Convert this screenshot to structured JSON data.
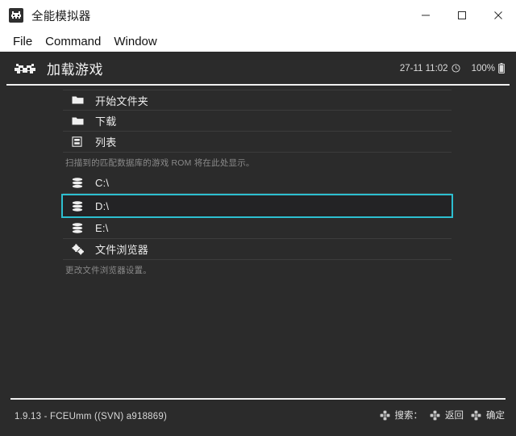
{
  "window": {
    "title": "全能模拟器",
    "app_icon": "arcade-invader-icon",
    "controls": {
      "minimize": "minimize-icon",
      "maximize": "maximize-icon",
      "close": "close-icon"
    }
  },
  "menubar": {
    "items": [
      {
        "label": "File"
      },
      {
        "label": "Command"
      },
      {
        "label": "Window"
      }
    ]
  },
  "header": {
    "icon": "space-invader-icon",
    "title": "加载游戏",
    "clock": {
      "text": "27-11 11:02",
      "icon": "clock-icon"
    },
    "battery": {
      "text": "100%",
      "icon": "battery-icon"
    }
  },
  "list": {
    "items": [
      {
        "icon": "folder-icon",
        "label": "开始文件夹",
        "selected": false
      },
      {
        "icon": "folder-icon",
        "label": "下载",
        "selected": false
      },
      {
        "icon": "list-icon",
        "label": "列表",
        "selected": false
      }
    ],
    "hint_scan": "扫描到的匹配数据库的游戏 ROM 将在此处显示。",
    "drives": [
      {
        "icon": "drive-icon",
        "label": "C:\\",
        "selected": false
      },
      {
        "icon": "drive-icon",
        "label": "D:\\",
        "selected": true
      },
      {
        "icon": "drive-icon",
        "label": "E:\\",
        "selected": false
      }
    ],
    "browser": {
      "icon": "settings-gear-icon",
      "label": "文件浏览器",
      "selected": false
    },
    "hint_browser": "更改文件浏览器设置。"
  },
  "footer": {
    "version": "1.9.13 - FCEUmm ((SVN) a918869)",
    "actions": [
      {
        "icon": "dpad-icon",
        "label": "搜索："
      },
      {
        "icon": "dpad-icon",
        "label": "返回"
      },
      {
        "icon": "dpad-icon",
        "label": "确定"
      }
    ]
  },
  "colors": {
    "accent": "#2dbfd0",
    "app_bg": "#2b2b2b",
    "titlebar_bg": "#ffffff",
    "divider": "#f0f0f0",
    "row_divider": "#3c3c3c"
  }
}
